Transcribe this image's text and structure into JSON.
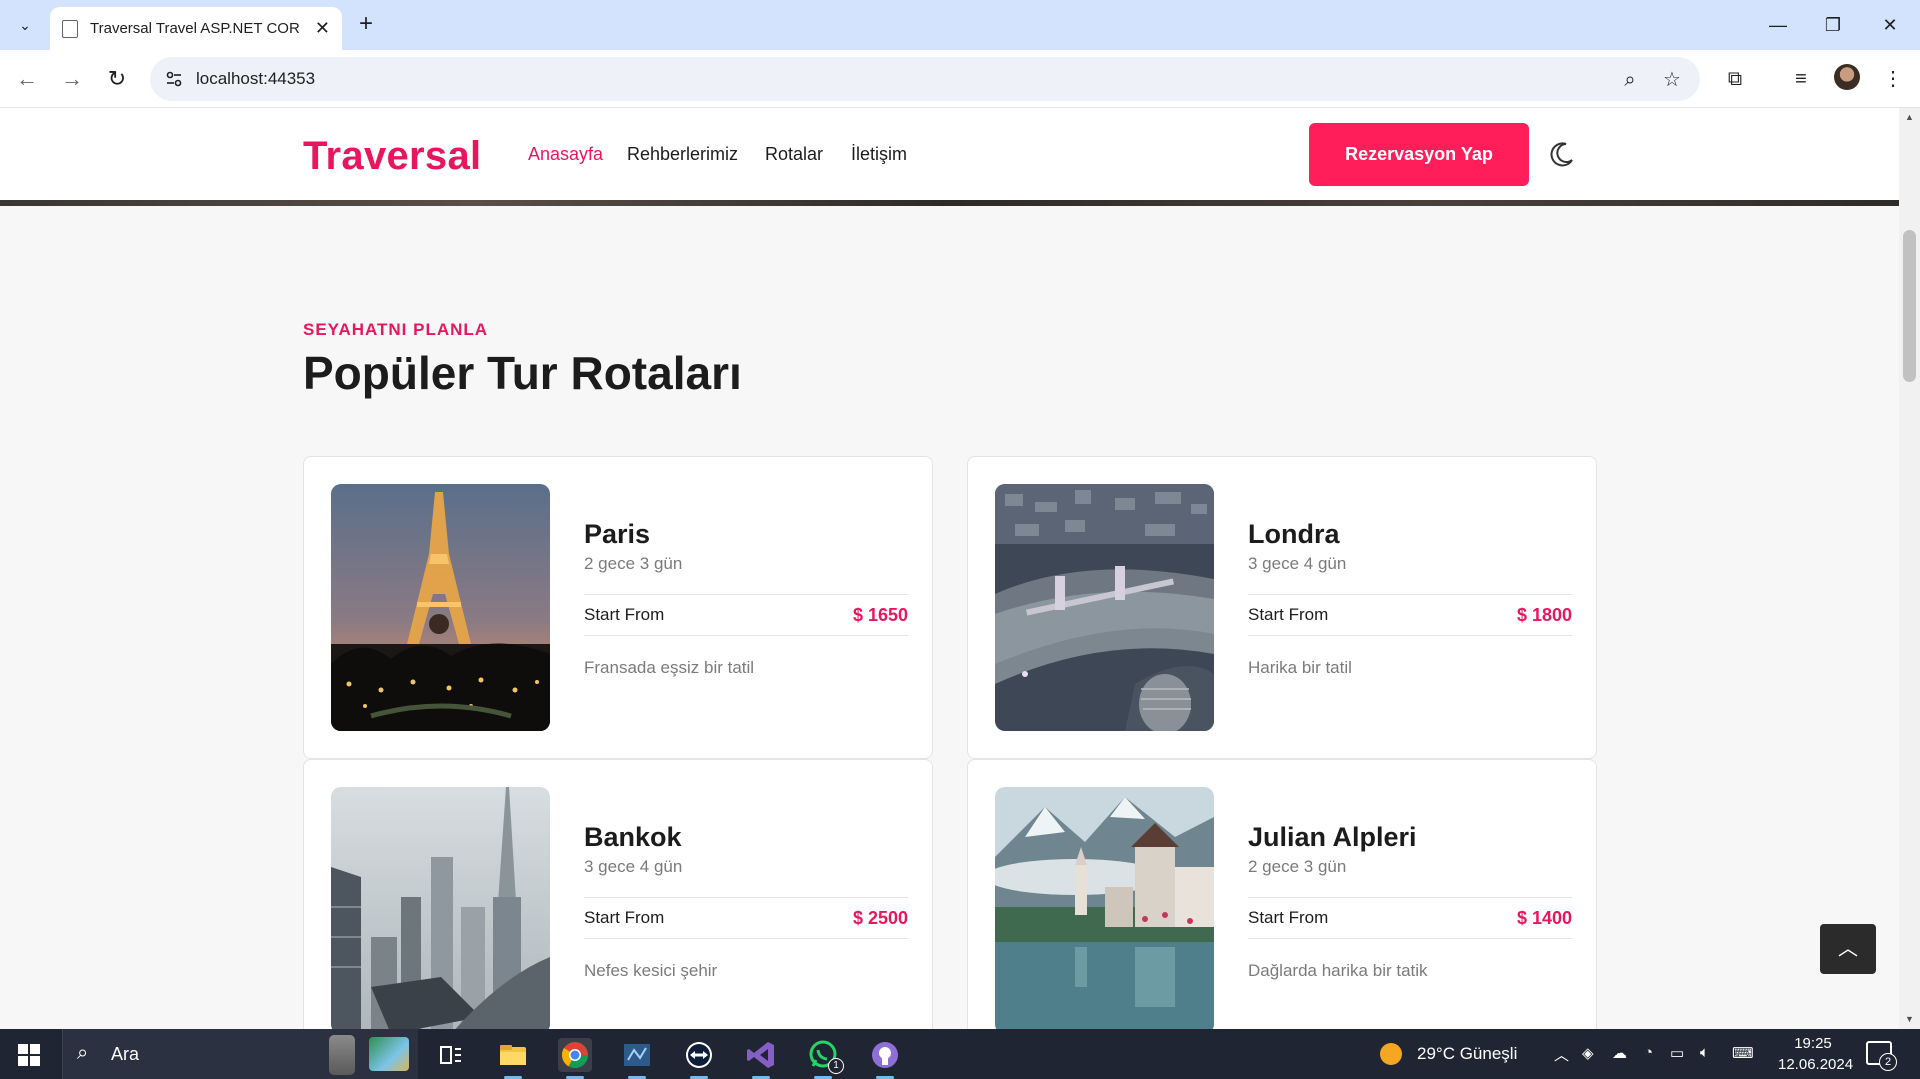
{
  "browser": {
    "tab_title": "Traversal Travel ASP.NET CORE I",
    "url": "localhost:44353",
    "new_tab_symbol": "+",
    "close_tab_symbol": "✕"
  },
  "site": {
    "brand": "Traversal",
    "nav": [
      "Anasayfa",
      "Rehberlerimiz",
      "Rotalar",
      "İletişim"
    ],
    "cta_label": "Rezervasyon Yap"
  },
  "section": {
    "tag": "SEYAHATNI PLANLA",
    "title": "Popüler Tur Rotaları"
  },
  "tours": [
    {
      "name": "Paris",
      "duration": "2 gece 3 gün",
      "price_label": "Start From",
      "price": "$ 1650",
      "description": "Fransada eşsiz bir tatil",
      "image": "eiffel-tower-night"
    },
    {
      "name": "Londra",
      "duration": "3 gece 4 gün",
      "price_label": "Start From",
      "price": "$ 1800",
      "description": "Harika bir tatil",
      "image": "tower-bridge-aerial"
    },
    {
      "name": "Bankok",
      "duration": "3 gece 4 gün",
      "price_label": "Start From",
      "price": "$ 2500",
      "description": "Nefes kesici şehir",
      "image": "city-skyline-towers"
    },
    {
      "name": "Julian Alpleri",
      "duration": "2 gece 3 gün",
      "price_label": "Start From",
      "price": "$ 1400",
      "description": "Dağlarda harika bir tatik",
      "image": "alpine-lake-village"
    }
  ],
  "taskbar": {
    "search_text": "Ara",
    "weather": "29°C Güneşli",
    "time": "19:25",
    "date": "12.06.2024",
    "notification_count": "2",
    "whatsapp_badge": "1"
  },
  "colors": {
    "brand": "#e8175d",
    "cta": "#ff1e5a",
    "taskbar": "#1f2532"
  }
}
